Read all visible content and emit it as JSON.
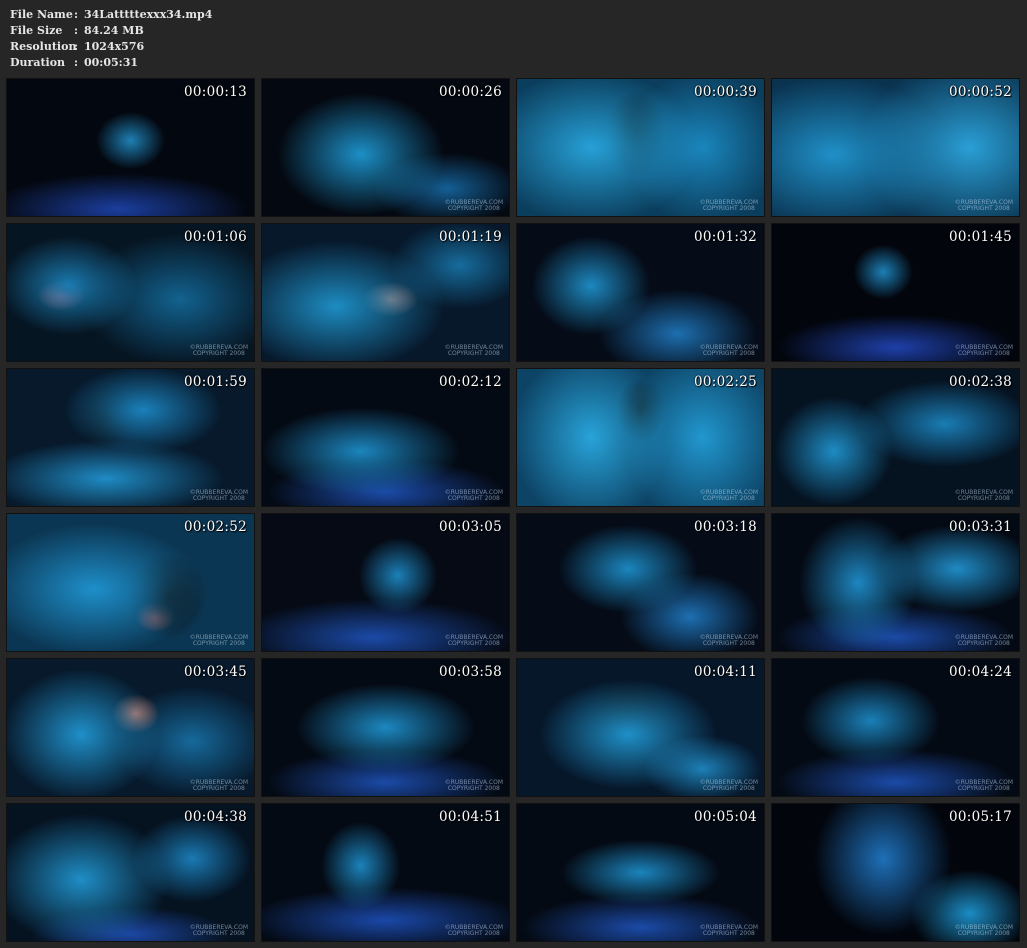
{
  "file_info": {
    "file_name_label": "File Name",
    "file_name": "34Latttttexxx34.mp4",
    "file_size_label": "File Size",
    "file_size": "84.24 MB",
    "resolution_label": "Resolution",
    "resolution": "1024x576",
    "duration_label": "Duration",
    "duration": "00:05:31",
    "separator": ":"
  },
  "watermark": {
    "line1": "©RUBBEREVA.COM",
    "line2": "COPYRIGHT 2008"
  },
  "thumbnails": [
    {
      "timestamp": "00:00:13"
    },
    {
      "timestamp": "00:00:26"
    },
    {
      "timestamp": "00:00:39"
    },
    {
      "timestamp": "00:00:52"
    },
    {
      "timestamp": "00:01:06"
    },
    {
      "timestamp": "00:01:19"
    },
    {
      "timestamp": "00:01:32"
    },
    {
      "timestamp": "00:01:45"
    },
    {
      "timestamp": "00:01:59"
    },
    {
      "timestamp": "00:02:12"
    },
    {
      "timestamp": "00:02:25"
    },
    {
      "timestamp": "00:02:38"
    },
    {
      "timestamp": "00:02:52"
    },
    {
      "timestamp": "00:03:05"
    },
    {
      "timestamp": "00:03:18"
    },
    {
      "timestamp": "00:03:31"
    },
    {
      "timestamp": "00:03:45"
    },
    {
      "timestamp": "00:03:58"
    },
    {
      "timestamp": "00:04:11"
    },
    {
      "timestamp": "00:04:24"
    },
    {
      "timestamp": "00:04:38"
    },
    {
      "timestamp": "00:04:51"
    },
    {
      "timestamp": "00:05:04"
    },
    {
      "timestamp": "00:05:17"
    }
  ]
}
